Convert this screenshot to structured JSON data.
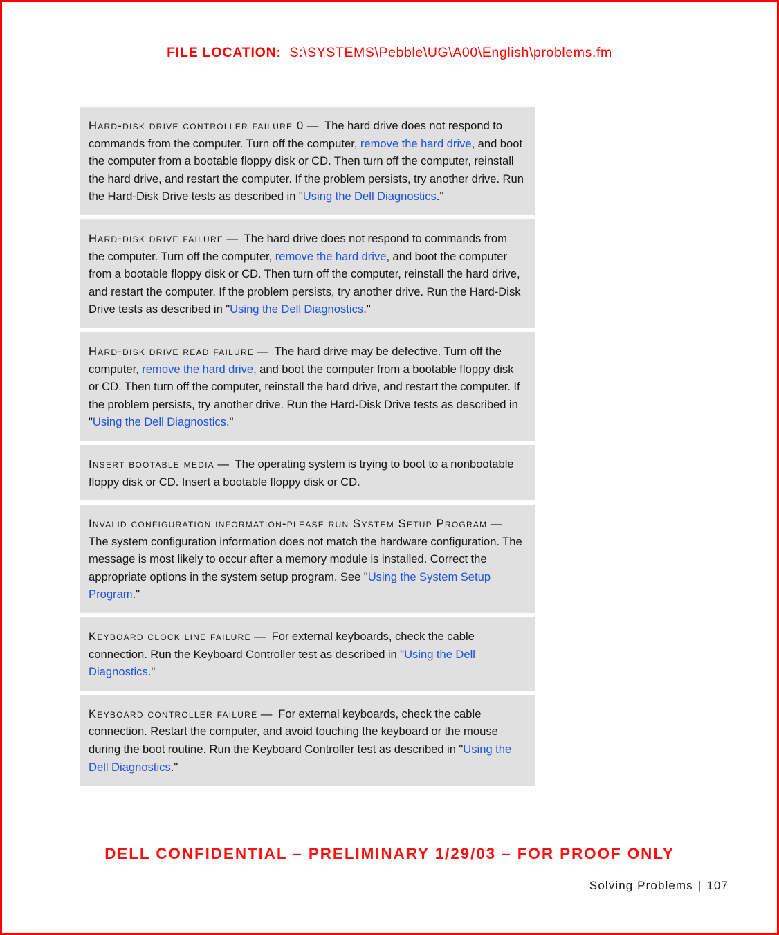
{
  "header": {
    "file_location_label": "FILE LOCATION:",
    "file_location_path": "S:\\SYSTEMS\\Pebble\\UG\\A00\\English\\problems.fm"
  },
  "footer": {
    "confidential_notice": "DELL CONFIDENTIAL – PRELIMINARY 1/29/03 – FOR PROOF ONLY",
    "chapter": "Solving Problems",
    "separator": "|",
    "page_number": "107"
  },
  "colors": {
    "red": "#ff0000",
    "link_blue": "#2053d8",
    "block_gray": "#e0e0e0",
    "body_text": "#161616"
  },
  "messages": [
    {
      "term": "Hard-disk drive controller failure 0",
      "dash": "—",
      "parts": [
        {
          "type": "text",
          "value": "The hard drive does not respond to commands from the computer. Turn off the computer, "
        },
        {
          "type": "link",
          "value": "remove the hard drive"
        },
        {
          "type": "text",
          "value": ", and boot the computer from a bootable floppy disk or CD. Then turn off the computer, reinstall the hard drive, and restart the computer. If the problem persists, try another drive. Run the Hard-Disk Drive tests as described in \""
        },
        {
          "type": "link",
          "value": "Using the Dell Diagnostics"
        },
        {
          "type": "text",
          "value": ".\""
        }
      ]
    },
    {
      "term": "Hard-disk drive failure",
      "dash": "—",
      "parts": [
        {
          "type": "text",
          "value": "The hard drive does not respond to commands from the computer. Turn off the computer, "
        },
        {
          "type": "link",
          "value": "remove the hard drive"
        },
        {
          "type": "text",
          "value": ", and boot the computer from a bootable floppy disk or CD. Then turn off the computer, reinstall the hard drive, and restart the computer. If the problem persists, try another drive. Run the Hard-Disk Drive tests as described in \""
        },
        {
          "type": "link",
          "value": "Using the Dell Diagnostics"
        },
        {
          "type": "text",
          "value": ".\""
        }
      ]
    },
    {
      "term": "Hard-disk drive read failure",
      "dash": "—",
      "parts": [
        {
          "type": "text",
          "value": "The hard drive may be defective. Turn off the computer, "
        },
        {
          "type": "link",
          "value": "remove the hard drive"
        },
        {
          "type": "text",
          "value": ", and boot the computer from a bootable floppy disk or CD. Then turn off the computer, reinstall the hard drive, and restart the computer. If the problem persists, try another drive. Run the Hard-Disk Drive tests as described in \""
        },
        {
          "type": "link",
          "value": "Using the Dell Diagnostics"
        },
        {
          "type": "text",
          "value": ".\""
        }
      ]
    },
    {
      "term": "Insert bootable media",
      "dash": "—",
      "parts": [
        {
          "type": "text",
          "value": "The operating system is trying to boot to a nonbootable floppy disk or CD. Insert a bootable floppy disk or CD."
        }
      ]
    },
    {
      "term": "Invalid configuration information-please run System Setup Program",
      "dash": "—",
      "parts": [
        {
          "type": "text",
          "value": "The system configuration information does not match the hardware configuration. The message is most likely to occur after a memory module is installed. Correct the appropriate options in the system setup program. See \""
        },
        {
          "type": "link",
          "value": "Using the System Setup Program"
        },
        {
          "type": "text",
          "value": ".\""
        }
      ]
    },
    {
      "term": "Keyboard clock line failure",
      "dash": "—",
      "parts": [
        {
          "type": "text",
          "value": "For external keyboards, check the cable connection. Run the Keyboard Controller test as described in \""
        },
        {
          "type": "link",
          "value": "Using the Dell Diagnostics"
        },
        {
          "type": "text",
          "value": ".\""
        }
      ]
    },
    {
      "term": "Keyboard controller failure",
      "dash": "—",
      "parts": [
        {
          "type": "text",
          "value": "For external keyboards, check the cable connection. Restart the computer, and avoid touching the keyboard or the mouse during the boot routine. Run the Keyboard Controller test as described in \""
        },
        {
          "type": "link",
          "value": "Using the Dell Diagnostics"
        },
        {
          "type": "text",
          "value": ".\""
        }
      ]
    }
  ]
}
